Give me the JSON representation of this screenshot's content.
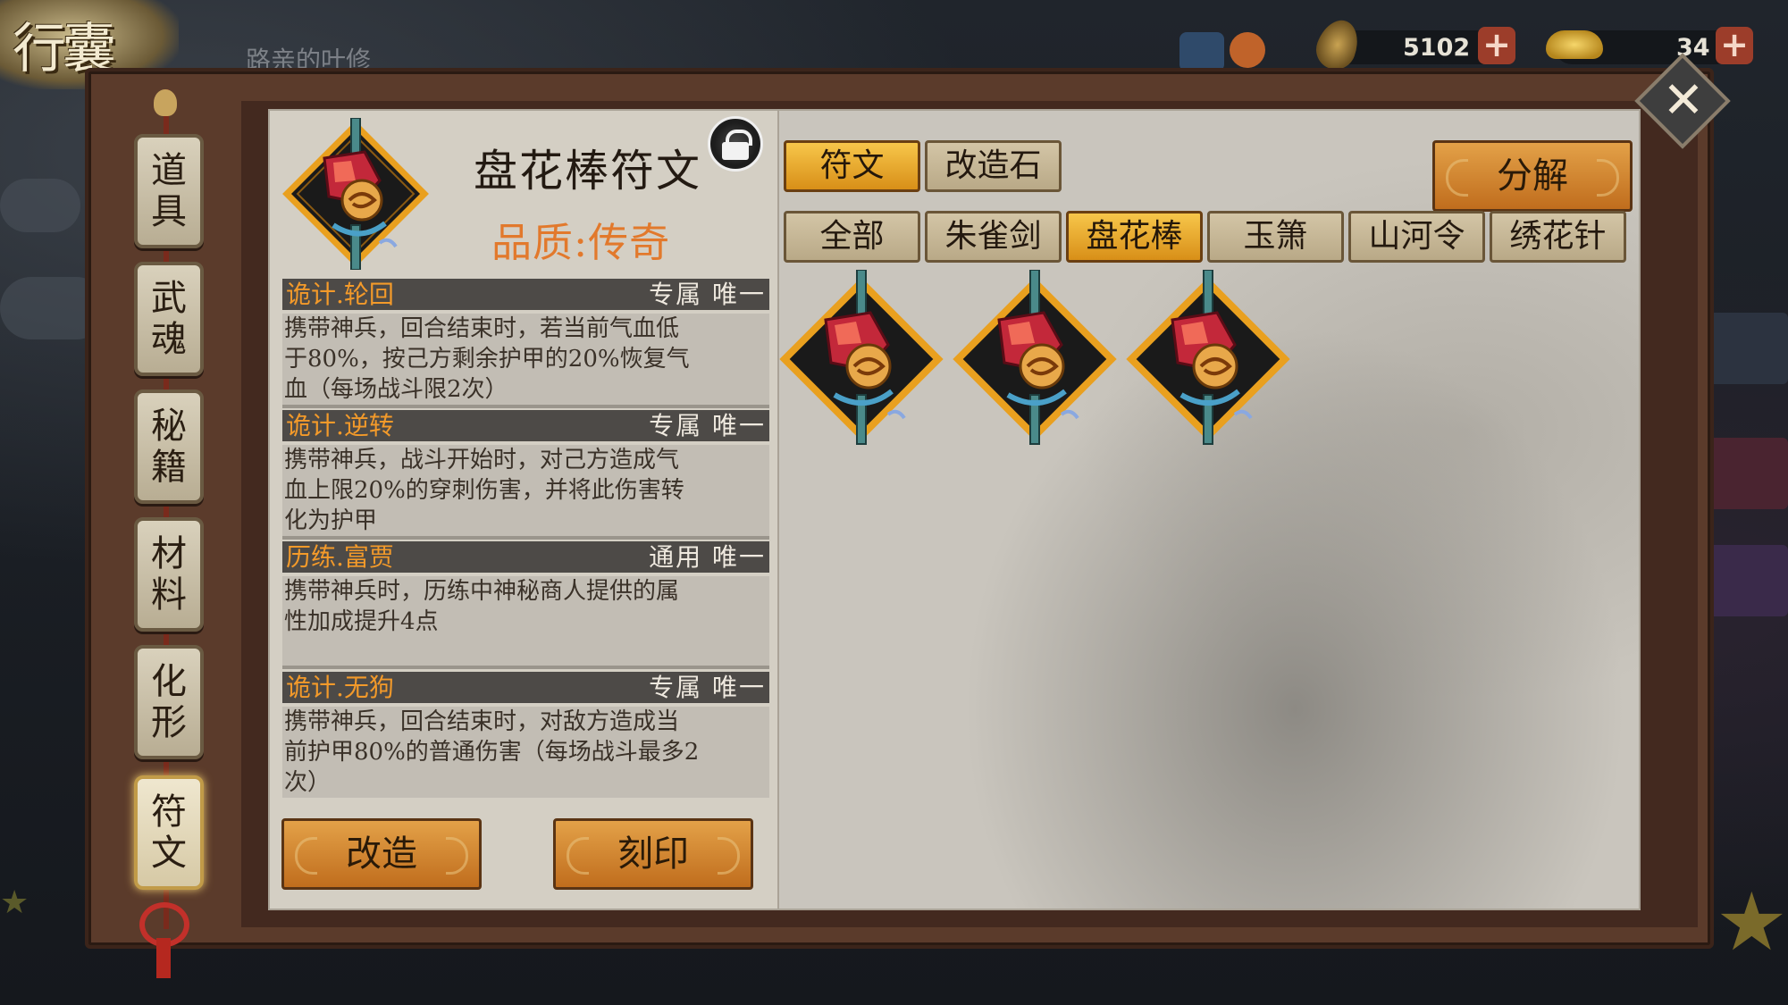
{
  "header": {
    "title": "行囊",
    "player_name": "路亲的叶修",
    "leaf_currency": "5102",
    "ingot_currency": "34"
  },
  "sidebar": {
    "items": [
      {
        "label": "道具",
        "active": false
      },
      {
        "label": "武魂",
        "active": false
      },
      {
        "label": "秘籍",
        "active": false
      },
      {
        "label": "材料",
        "active": false
      },
      {
        "label": "化形",
        "active": false
      },
      {
        "label": "符文",
        "active": true
      }
    ]
  },
  "item": {
    "name": "盘花棒符文",
    "quality": "品质:传奇",
    "icon": "rune-gem-icon"
  },
  "effects": [
    {
      "name": "诡计.轮回",
      "tags": "专属 唯一",
      "lines": [
        "携带神兵，回合结束时，若当前气血低",
        "于80%，按己方剩余护甲的20%恢复气",
        "血（每场战斗限2次）"
      ]
    },
    {
      "name": "诡计.逆转",
      "tags": "专属 唯一",
      "lines": [
        "携带神兵，战斗开始时，对己方造成气",
        "血上限20%的穿刺伤害，并将此伤害转",
        "化为护甲"
      ]
    },
    {
      "name": "历练.富贾",
      "tags": "通用 唯一",
      "lines": [
        "携带神兵时，历练中神秘商人提供的属",
        "性加成提升4点"
      ]
    },
    {
      "name": "诡计.无狗",
      "tags": "专属 唯一",
      "lines": [
        "携带神兵，回合结束时，对敌方造成当",
        "前护甲80%的普通伤害（每场战斗最多2",
        "次）"
      ]
    }
  ],
  "actions": {
    "reforge": "改造",
    "engrave": "刻印",
    "decompose": "分解"
  },
  "type_tabs": [
    {
      "label": "符文",
      "active": true
    },
    {
      "label": "改造石",
      "active": false
    }
  ],
  "filter_tabs": [
    {
      "label": "全部",
      "active": false
    },
    {
      "label": "朱雀剑",
      "active": false
    },
    {
      "label": "盘花棒",
      "active": true
    },
    {
      "label": "玉箫",
      "active": false
    },
    {
      "label": "山河令",
      "active": false
    },
    {
      "label": "绣花针",
      "active": false
    }
  ],
  "rune_count": 3,
  "colors": {
    "quality": "#e2792c",
    "effect_name": "#f39a2a",
    "active_tab": "#f2b93a"
  }
}
